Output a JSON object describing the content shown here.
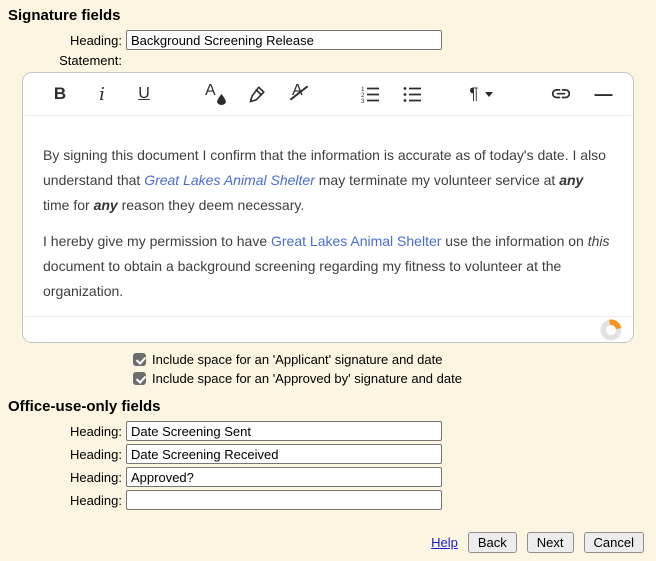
{
  "colors": {
    "page_bg": "#fcf5e1",
    "content_link": "#4a6bd4",
    "help_link": "#1a1ad6",
    "spinner_ring": "#e2e2e2",
    "spinner_segment": "#f7941d",
    "checkbox_checked": "#6d6d6d"
  },
  "signature": {
    "title": "Signature fields",
    "heading_label": "Heading:",
    "heading_value": "Background Screening Release",
    "statement_label": "Statement:"
  },
  "editor": {
    "toolbar": {
      "bold_glyph": "B",
      "italic_glyph": "i",
      "underline_glyph": "U",
      "color_glyph": "A",
      "clear_glyph": "A",
      "paragraph_glyph": "¶",
      "hr_glyph": "—",
      "icon_names": [
        "bold",
        "italic",
        "underline",
        "text-color",
        "highlight-marker",
        "clear-formatting",
        "numbered-list",
        "bullet-list",
        "paragraph-format",
        "insert-link",
        "horizontal-rule"
      ]
    },
    "statement": {
      "p1_text1": "By signing this document I confirm that the information is accurate as of today's date. I also understand that ",
      "p1_link": "Great Lakes Animal Shelter",
      "p1_text2": " may terminate my volunteer service at ",
      "p1_bold1": "any",
      "p1_text3": " time for ",
      "p1_bold2": "any",
      "p1_text4": " reason they deem necessary.",
      "p2_text1": "I hereby give my permission to have ",
      "p2_link": "Great Lakes Animal Shelter",
      "p2_text2": " use the information on ",
      "p2_italic": "this",
      "p2_text3": " document to obtain a background screening regarding my fitness to volunteer at the organization."
    }
  },
  "checkboxes": [
    {
      "label": "Include space for an 'Applicant' signature and date",
      "checked": true
    },
    {
      "label": "Include space for an 'Approved by' signature and date",
      "checked": true
    }
  ],
  "office": {
    "title": "Office-use-only fields",
    "fields": [
      {
        "label": "Heading:",
        "value": "Date Screening Sent"
      },
      {
        "label": "Heading:",
        "value": "Date Screening Received"
      },
      {
        "label": "Heading:",
        "value": "Approved?"
      },
      {
        "label": "Heading:",
        "value": ""
      }
    ]
  },
  "footer": {
    "help": "Help",
    "back": "Back",
    "next": "Next",
    "cancel": "Cancel"
  }
}
